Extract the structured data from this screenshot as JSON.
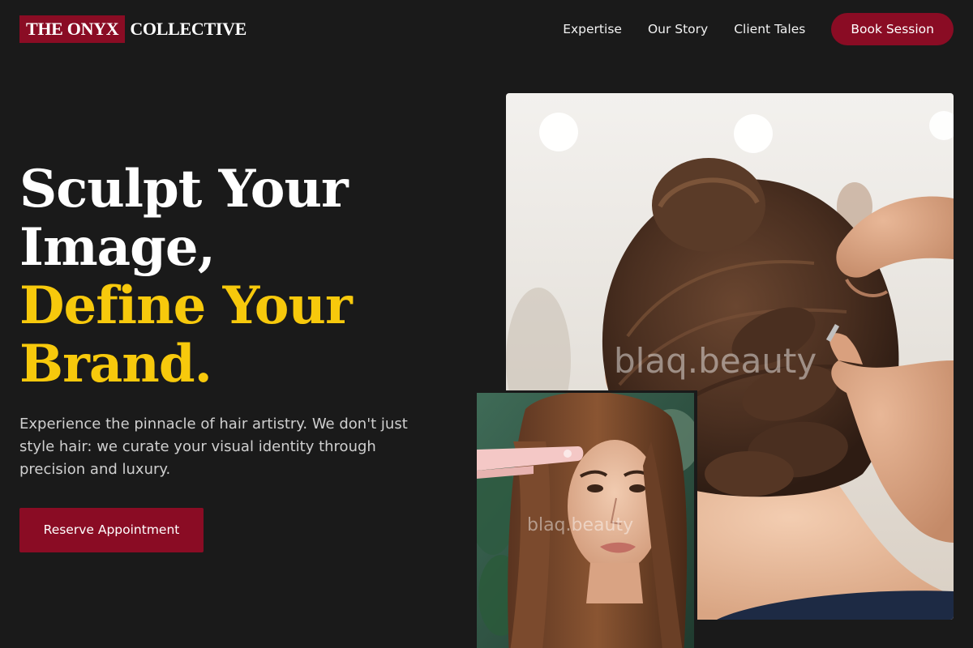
{
  "brand": {
    "logo_highlight": "THE ONYX",
    "logo_rest": "COLLECTIVE"
  },
  "nav": {
    "links": [
      "Expertise",
      "Our Story",
      "Client Tales"
    ],
    "cta": "Book Session"
  },
  "hero": {
    "headline_line1": "Sculpt Your",
    "headline_line2": "Image,",
    "headline_line3": "Define Your",
    "headline_line4": "Brand.",
    "subtext": "Experience the pinnacle of hair artistry. We don't just style hair: we curate your visual identity through precision and luxury.",
    "cta": "Reserve Appointment"
  },
  "images": {
    "main_alt": "Stylist pinning curled updo on client",
    "small_alt": "Woman with straightened long hair and pink flat iron",
    "watermark": "blaq.beauty"
  },
  "colors": {
    "background": "#1a1a1a",
    "brand_red": "#8a0c24",
    "accent_yellow": "#f7c90c",
    "text_white": "#ffffff",
    "text_muted": "#cfcfcf"
  }
}
